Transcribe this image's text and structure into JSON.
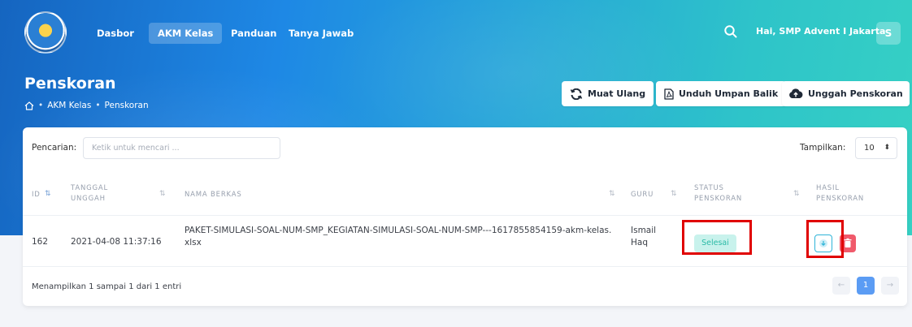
{
  "nav": {
    "items": [
      "Dasbor",
      "AKM Kelas",
      "Panduan",
      "Tanya Jawab"
    ],
    "active_index": 1,
    "greeting": "Hai, SMP Advent I Jakarta",
    "avatar_initial": "S"
  },
  "header": {
    "title": "Penskoran",
    "breadcrumb": [
      "AKM Kelas",
      "Penskoran"
    ],
    "buttons": {
      "reload": "Muat Ulang",
      "download_feedback": "Unduh Umpan Balik",
      "upload_scoring": "Unggah Penskoran"
    }
  },
  "table_controls": {
    "search_label": "Pencarian:",
    "search_placeholder": "Ketik untuk mencari ...",
    "show_label": "Tampilkan:",
    "show_value": "10"
  },
  "table": {
    "columns": {
      "id": "ID",
      "upload_date": "TANGGAL UNGGAH",
      "file_name": "NAMA BERKAS",
      "teacher": "GURU",
      "scoring_status": "STATUS PENSKORAN",
      "scoring_result": "HASIL PENSKORAN"
    },
    "rows": [
      {
        "id": "162",
        "upload_date": "2021-04-08 11:37:16",
        "file_name": "PAKET-SIMULASI-SOAL-NUM-SMP_KEGIATAN-SIMULASI-SOAL-NUM-SMP---1617855854159-akm-kelas.xlsx",
        "teacher": "Ismail Haq",
        "status": "Selesai"
      }
    ]
  },
  "footer": {
    "info": "Menampilkan 1 sampai 1 dari 1 entri",
    "current_page": "1",
    "prev": "←",
    "next": "→"
  },
  "colors": {
    "brand_gradient_start": "#1565c0",
    "brand_gradient_end": "#36d1c4",
    "status_success_bg": "#c8f2ec",
    "status_success_text": "#2bbba6",
    "danger": "#f05a6b",
    "highlight": "#e00000"
  },
  "icons": {
    "reload": "refresh-icon",
    "download_feedback": "pdf-file-icon",
    "upload_scoring": "cloud-upload-icon",
    "search": "search-icon",
    "home": "home-icon",
    "download": "download-icon",
    "delete": "trash-icon"
  }
}
